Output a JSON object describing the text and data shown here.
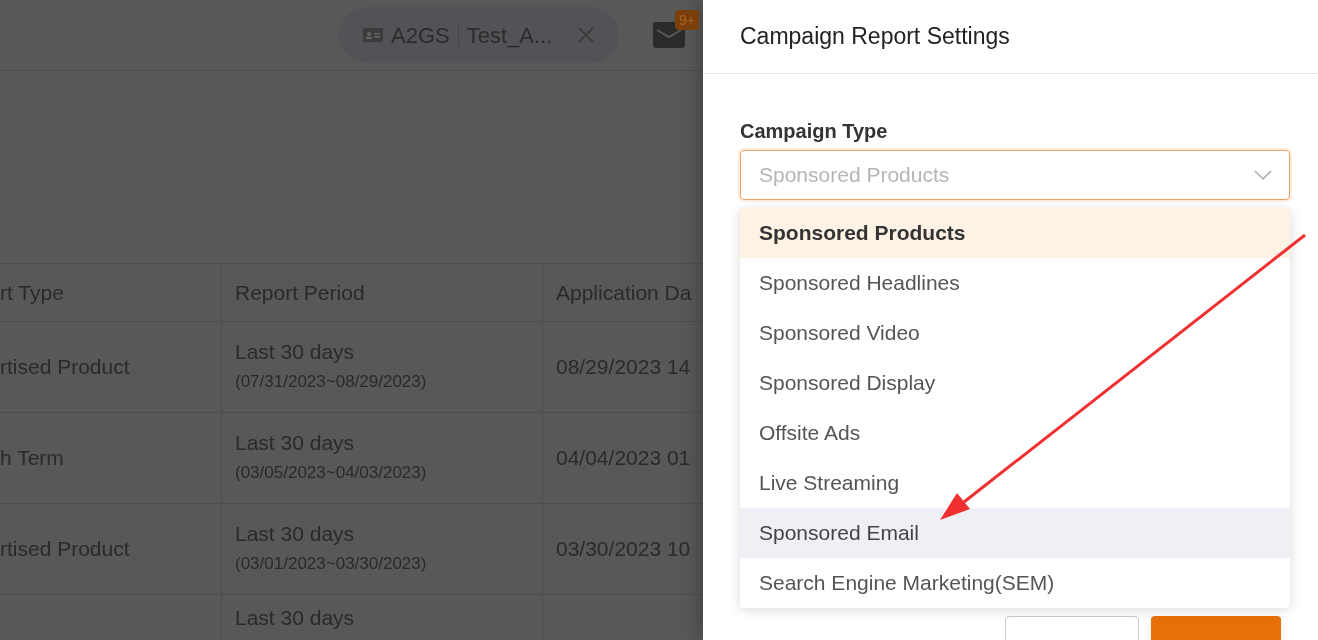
{
  "header": {
    "account_chip": {
      "code": "A2GS",
      "name": "Test_A..."
    },
    "notifications": {
      "badge": "9+"
    }
  },
  "table": {
    "columns": [
      "rt Type",
      "Report Period",
      "Application Da"
    ],
    "rows": [
      {
        "type": "rtised Product",
        "period": "Last 30 days",
        "range": "(07/31/2023~08/29/2023)",
        "applied": "08/29/2023 14"
      },
      {
        "type": "h Term",
        "period": "Last 30 days",
        "range": "(03/05/2023~04/03/2023)",
        "applied": "04/04/2023 01"
      },
      {
        "type": "rtised Product",
        "period": "Last 30 days",
        "range": "(03/01/2023~03/30/2023)",
        "applied": "03/30/2023 10"
      },
      {
        "period": "Last 30 days"
      }
    ]
  },
  "drawer": {
    "title": "Campaign Report Settings",
    "field": {
      "label": "Campaign Type",
      "placeholder": "Sponsored Products"
    },
    "options": [
      {
        "label": "Sponsored Products",
        "selected": true,
        "hovered": false
      },
      {
        "label": "Sponsored Headlines",
        "selected": false,
        "hovered": false
      },
      {
        "label": "Sponsored Video",
        "selected": false,
        "hovered": false
      },
      {
        "label": "Sponsored Display",
        "selected": false,
        "hovered": false
      },
      {
        "label": "Offsite Ads",
        "selected": false,
        "hovered": false
      },
      {
        "label": "Live Streaming",
        "selected": false,
        "hovered": false
      },
      {
        "label": "Sponsored Email",
        "selected": false,
        "hovered": true
      },
      {
        "label": "Search Engine Marketing(SEM)",
        "selected": false,
        "hovered": false
      }
    ]
  }
}
